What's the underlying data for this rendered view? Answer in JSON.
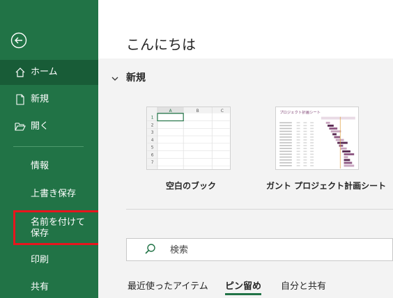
{
  "sidebar": {
    "back_label": "",
    "home": "ホーム",
    "new": "新規",
    "open": "開く",
    "info": "情報",
    "save": "上書き保存",
    "save_as": "名前を付けて保存",
    "print": "印刷",
    "share": "共有"
  },
  "main": {
    "greeting": "こんにちは",
    "new_section_title": "新規",
    "templates": [
      {
        "label": "空白のブック",
        "col_headers": [
          "A",
          "B",
          "C"
        ],
        "rows": [
          "1",
          "2",
          "3",
          "4",
          "5",
          "6",
          "7"
        ]
      },
      {
        "label": "ガント プロジェクト計画シート",
        "thumb_title": "プロジェクト計画シート"
      }
    ],
    "search": {
      "placeholder": "検索"
    },
    "tabs": [
      "最近使ったアイテム",
      "ピン留め",
      "自分と共有"
    ],
    "active_tab": "ピン留め"
  },
  "colors": {
    "sidebar_bg": "#217346",
    "sidebar_active": "#185c37",
    "highlight": "#e8151d",
    "gantt_bar": "#5c2d55"
  }
}
